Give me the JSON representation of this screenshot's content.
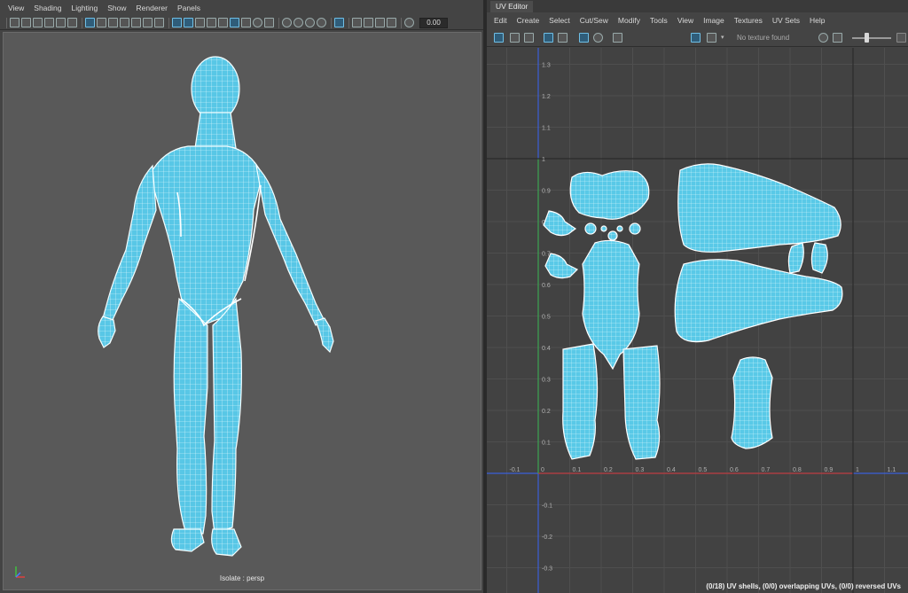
{
  "viewport": {
    "menu": [
      "View",
      "Shading",
      "Lighting",
      "Show",
      "Renderer",
      "Panels"
    ],
    "field_value": "0.00",
    "caption": "Isolate : persp"
  },
  "uv_editor": {
    "tab": "UV Editor",
    "menu": [
      "Edit",
      "Create",
      "Select",
      "Cut/Sew",
      "Modify",
      "Tools",
      "View",
      "Image",
      "Textures",
      "UV Sets",
      "Help"
    ],
    "texture_status": "No texture found",
    "status": "(0/18) UV shells, (0/0) overlapping UVs, (0/0) reversed UVs",
    "axis_labels_v": [
      "1.3",
      "1.2",
      "1.1",
      "1",
      "0.9",
      "0.8",
      "0.7",
      "0.6",
      "0.5",
      "0.4",
      "0.3",
      "0.2",
      "0.1",
      "-0.1",
      "-0.2",
      "-0.3"
    ],
    "axis_labels_u": [
      "-0.1",
      "0",
      "0.1",
      "0.2",
      "0.3",
      "0.4",
      "0.5",
      "0.6",
      "0.7",
      "0.8",
      "0.9",
      "1",
      "1.1"
    ]
  },
  "colors": {
    "mesh": "#55c8e8",
    "wire": "#e8fbff",
    "grid": "#4d4d4d",
    "u_axis": "#c0392b",
    "v_axis": "#3ea23e",
    "panel": "#444444"
  }
}
